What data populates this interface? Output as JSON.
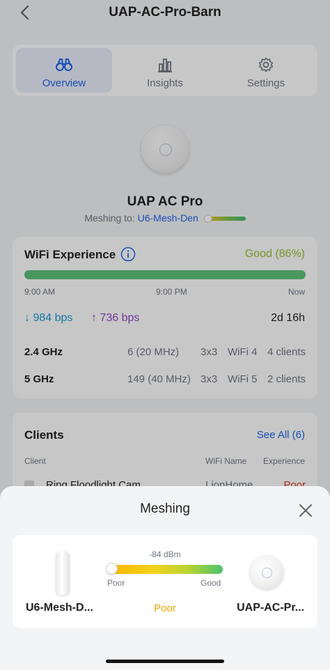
{
  "header": {
    "title": "UAP-AC-Pro-Barn",
    "back_icon": "chevron-left-icon"
  },
  "tabs": [
    {
      "label": "Overview",
      "icon": "binoculars-icon",
      "active": true
    },
    {
      "label": "Insights",
      "icon": "bar-chart-icon",
      "active": false
    },
    {
      "label": "Settings",
      "icon": "gear-icon",
      "active": false
    }
  ],
  "device": {
    "name": "UAP AC Pro",
    "meshing_prefix": "Meshing to:",
    "meshing_target": "U6-Mesh-Den"
  },
  "wifi": {
    "title": "WiFi Experience",
    "score": "Good (86%)",
    "times": [
      "9:00 AM",
      "9:00 PM",
      "Now"
    ],
    "download": "984 bps",
    "upload": "736 bps",
    "uptime": "2d 16h",
    "bands": [
      {
        "name": "2.4 GHz",
        "channel": "6 (20 MHz)",
        "mimo": "3x3",
        "standard": "WiFi 4",
        "clients": "4 clients"
      },
      {
        "name": "5 GHz",
        "channel": "149 (40 MHz)",
        "mimo": "3x3",
        "standard": "WiFi 5",
        "clients": "2 clients"
      }
    ]
  },
  "clients": {
    "title": "Clients",
    "see_all": "See All (6)",
    "columns": [
      "Client",
      "WiFi Name",
      "Experience"
    ],
    "rows": [
      {
        "name": "Ring Floodlight Cam",
        "wifi": "LionHome",
        "experience": "Poor"
      }
    ]
  },
  "sheet": {
    "title": "Meshing",
    "uplink_name": "U6-Mesh-D...",
    "signal": "-84 dBm",
    "signal_level": 0.0,
    "poor_label": "Poor",
    "good_label": "Good",
    "quality": "Poor",
    "device_name": "UAP-AC-Pr..."
  },
  "colors": {
    "accent": "#1e63e9",
    "good": "#9bbb2f",
    "poor": "#f0a500",
    "download": "#1b9ad6",
    "upload": "#8e4cc4"
  }
}
